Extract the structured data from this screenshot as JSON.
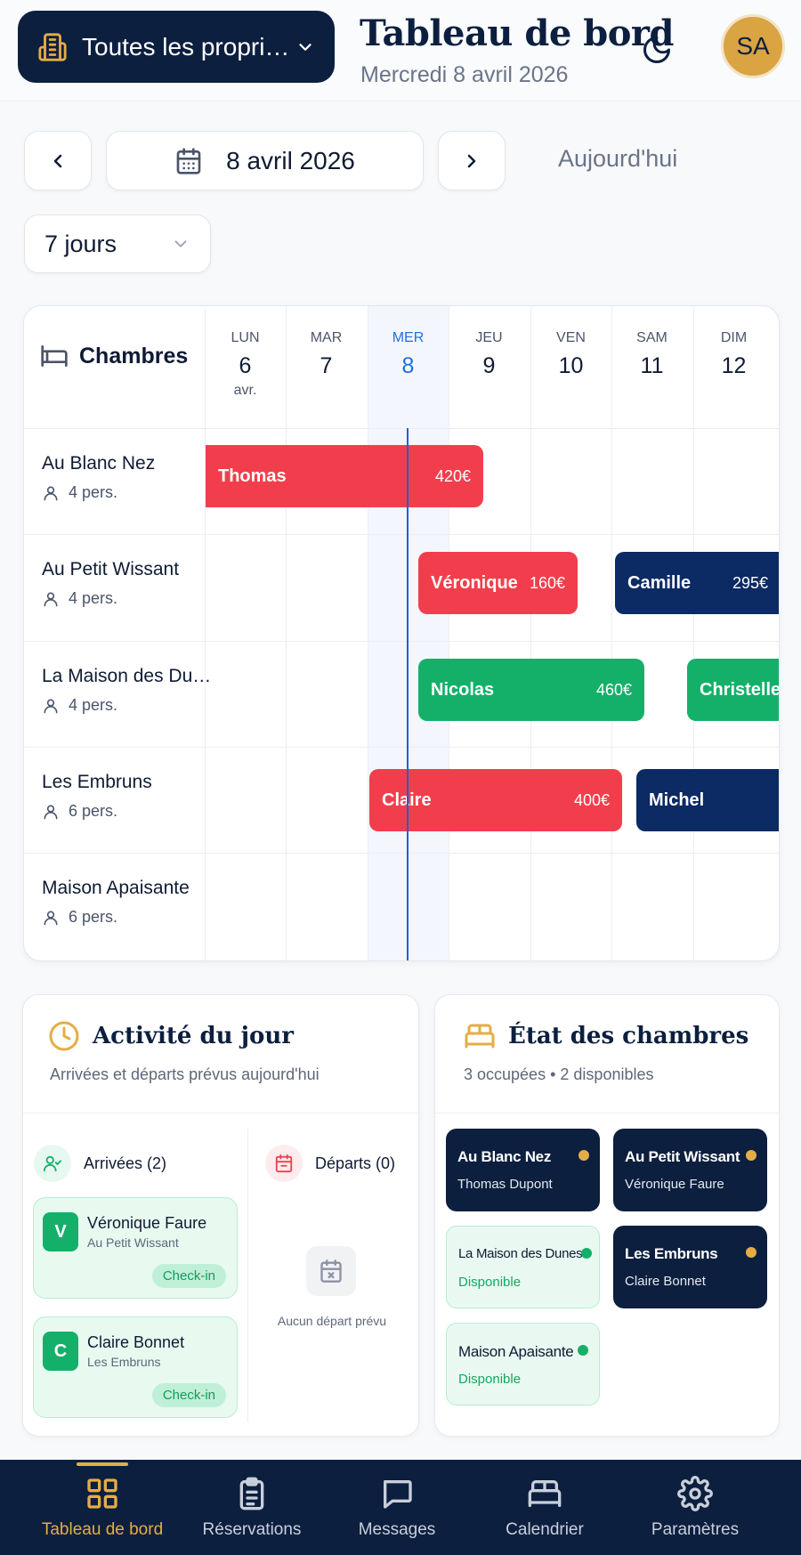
{
  "header": {
    "property_select": "Toutes les propri…",
    "title": "Tableau de bord",
    "date": "Mercredi 8 avril 2026",
    "avatar": "SA"
  },
  "date_nav": {
    "current": "8 avril 2026",
    "today": "Aujourd'hui",
    "range": "7 jours"
  },
  "planning": {
    "rooms_label": "Chambres",
    "days": [
      {
        "name": "LUN",
        "num": "6",
        "month": "avr."
      },
      {
        "name": "MAR",
        "num": "7",
        "month": ""
      },
      {
        "name": "MER",
        "num": "8",
        "month": ""
      },
      {
        "name": "JEU",
        "num": "9",
        "month": ""
      },
      {
        "name": "VEN",
        "num": "10",
        "month": ""
      },
      {
        "name": "SAM",
        "num": "11",
        "month": ""
      },
      {
        "name": "DIM",
        "num": "12",
        "month": ""
      }
    ],
    "rooms": [
      {
        "name": "Au Blanc Nez",
        "capacity": "4 pers."
      },
      {
        "name": "Au Petit Wissant",
        "capacity": "4 pers."
      },
      {
        "name": "La Maison des Du…",
        "capacity": "4 pers."
      },
      {
        "name": "Les Embruns",
        "capacity": "6 pers."
      },
      {
        "name": "Maison Apaisante",
        "capacity": "6 pers."
      }
    ],
    "bookings": [
      {
        "guest": "Thomas",
        "price": "420€",
        "color": "#f23e4c"
      },
      {
        "guest": "Véronique",
        "price": "160€",
        "color": "#f23e4c"
      },
      {
        "guest": "Camille",
        "price": "295€",
        "color": "#0c2a63"
      },
      {
        "guest": "Nicolas",
        "price": "460€",
        "color": "#14b06a"
      },
      {
        "guest": "Christelle",
        "price": "",
        "color": "#14b06a"
      },
      {
        "guest": "Claire",
        "price": "400€",
        "color": "#f23e4c"
      },
      {
        "guest": "Michel",
        "price": "",
        "color": "#0c2a63"
      }
    ]
  },
  "activity": {
    "title": "Activité du jour",
    "subtitle": "Arrivées et départs prévus aujourd'hui",
    "arrivals_label": "Arrivées (2)",
    "departures_label": "Départs (0)",
    "arrivals": [
      {
        "initial": "V",
        "name": "Véronique Faure",
        "room": "Au Petit Wissant",
        "action": "Check-in"
      },
      {
        "initial": "C",
        "name": "Claire Bonnet",
        "room": "Les Embruns",
        "action": "Check-in"
      }
    ],
    "no_departure": "Aucun départ prévu"
  },
  "rooms_state": {
    "title": "État des chambres",
    "summary": "3 occupées",
    "summary2": "2 disponibles",
    "tiles": [
      {
        "name": "Au Blanc Nez",
        "status": "Thomas Dupont"
      },
      {
        "name": "Au Petit Wissant",
        "status": "Véronique Faure"
      },
      {
        "name": "La Maison des Dunes",
        "status": "Disponible"
      },
      {
        "name": "Les Embruns",
        "status": "Claire Bonnet"
      },
      {
        "name": "Maison Apaisante",
        "status": "Disponible"
      }
    ]
  },
  "bottom_nav": [
    {
      "label": "Tableau de bord",
      "icon": "dashboard-icon"
    },
    {
      "label": "Réservations",
      "icon": "clipboard-icon"
    },
    {
      "label": "Messages",
      "icon": "chat-icon"
    },
    {
      "label": "Calendrier",
      "icon": "bed-icon"
    },
    {
      "label": "Paramètres",
      "icon": "gear-icon"
    }
  ],
  "colors": {
    "navy": "#0c1f3f",
    "accent": "#e5ad45",
    "red": "#f23e4c",
    "green": "#14b06a",
    "today_blue": "#1f6fe0"
  }
}
